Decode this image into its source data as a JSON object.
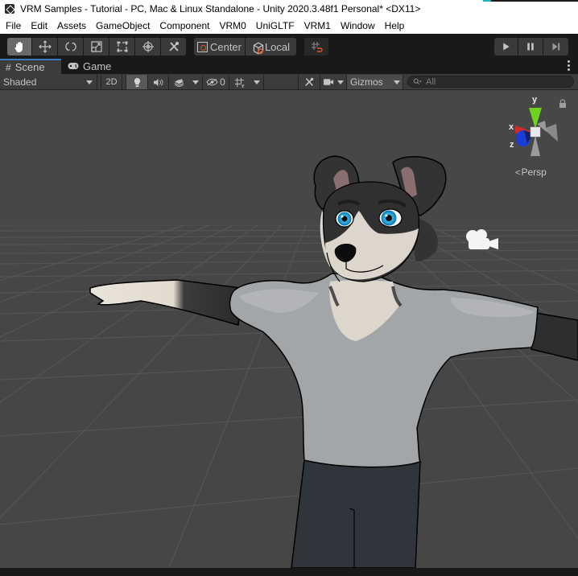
{
  "window": {
    "title": "VRM Samples - Tutorial - PC, Mac & Linux Standalone - Unity 2020.3.48f1 Personal* <DX11>",
    "app_icon": "unity-logo-icon"
  },
  "menu": {
    "items": [
      "File",
      "Edit",
      "Assets",
      "GameObject",
      "Component",
      "VRM0",
      "UniGLTF",
      "VRM1",
      "Window",
      "Help"
    ]
  },
  "toolbar": {
    "tools": [
      {
        "name": "hand-tool",
        "icon": "hand-icon",
        "active": true
      },
      {
        "name": "move-tool",
        "icon": "move-arrows-icon",
        "active": false
      },
      {
        "name": "rotate-tool",
        "icon": "rotate-icon",
        "active": false
      },
      {
        "name": "scale-tool",
        "icon": "scale-icon",
        "active": false
      },
      {
        "name": "rect-tool",
        "icon": "rect-transform-icon",
        "active": false
      },
      {
        "name": "transform-tool",
        "icon": "transform-icon",
        "active": false
      },
      {
        "name": "custom-tool",
        "icon": "tools-icon",
        "active": false
      }
    ],
    "pivot_mode": "Center",
    "pivot_rotation": "Local",
    "play": {
      "play_icon": "play-icon",
      "pause_icon": "pause-icon",
      "step_icon": "step-icon"
    }
  },
  "tabs": [
    {
      "label": "Scene",
      "icon": "scene-grid-icon",
      "active": true
    },
    {
      "label": "Game",
      "icon": "gamepad-icon",
      "active": false
    }
  ],
  "scene_toolbar": {
    "draw_mode": "Shaded",
    "toggle_2d": "2D",
    "hidden_count": "0",
    "gizmos_label": "Gizmos",
    "search_placeholder": "All"
  },
  "viewport": {
    "gizmo_axes": {
      "x": "x",
      "y": "y",
      "z": "z"
    },
    "projection_label": "Persp",
    "colors": {
      "background": "#474747",
      "axis_x": "#d42a2a",
      "axis_y": "#6fd21e",
      "axis_z": "#1c3cd8",
      "shirt": "#a3a6a9",
      "pants": "#30343b",
      "fur_dark": "#2f2f2f",
      "fur_light": "#ddd6cc",
      "eye": "#27a7d8"
    }
  }
}
